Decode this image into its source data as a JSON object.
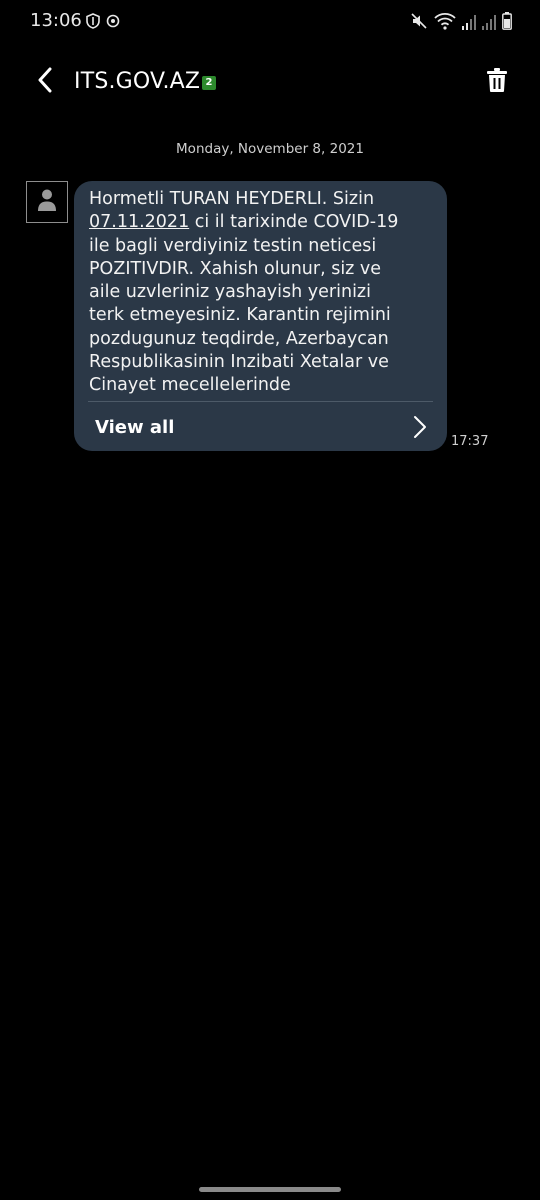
{
  "status_bar": {
    "time": "13:06",
    "left_icons": [
      "shield-icon",
      "sync-icon"
    ],
    "right_icons": [
      "mute-icon",
      "wifi-icon",
      "signal-icon",
      "signal-icon",
      "battery-icon"
    ]
  },
  "header": {
    "title": "ITS.GOV.AZ",
    "badge": "2",
    "back_icon": "chevron-left-icon",
    "delete_icon": "trash-icon"
  },
  "conversation": {
    "date_separator": "Monday, November 8, 2021",
    "message": {
      "sender_avatar": "person-icon",
      "text_before_date": "Hormetli TURAN HEYDERLI. Sizin\n",
      "date_link": "07.11.2021",
      "text_after_date": " ci il tarixinde COVID-19\nile bagli verdiyiniz testin neticesi\nPOZITIVDIR. Xahish olunur, siz ve\naile uzvleriniz yashayish yerinizi\nterk etmeyesiniz. Karantin rejimini\npozdugunuz teqdirde, Azerbaycan\nRespublikasinin Inzibati Xetalar ve\nCinayet mecellelerinde",
      "view_all_label": "View all",
      "time": "17:37"
    }
  },
  "colors": {
    "background": "#000000",
    "bubble": "#2b3847",
    "badge": "#2d8a2d"
  }
}
